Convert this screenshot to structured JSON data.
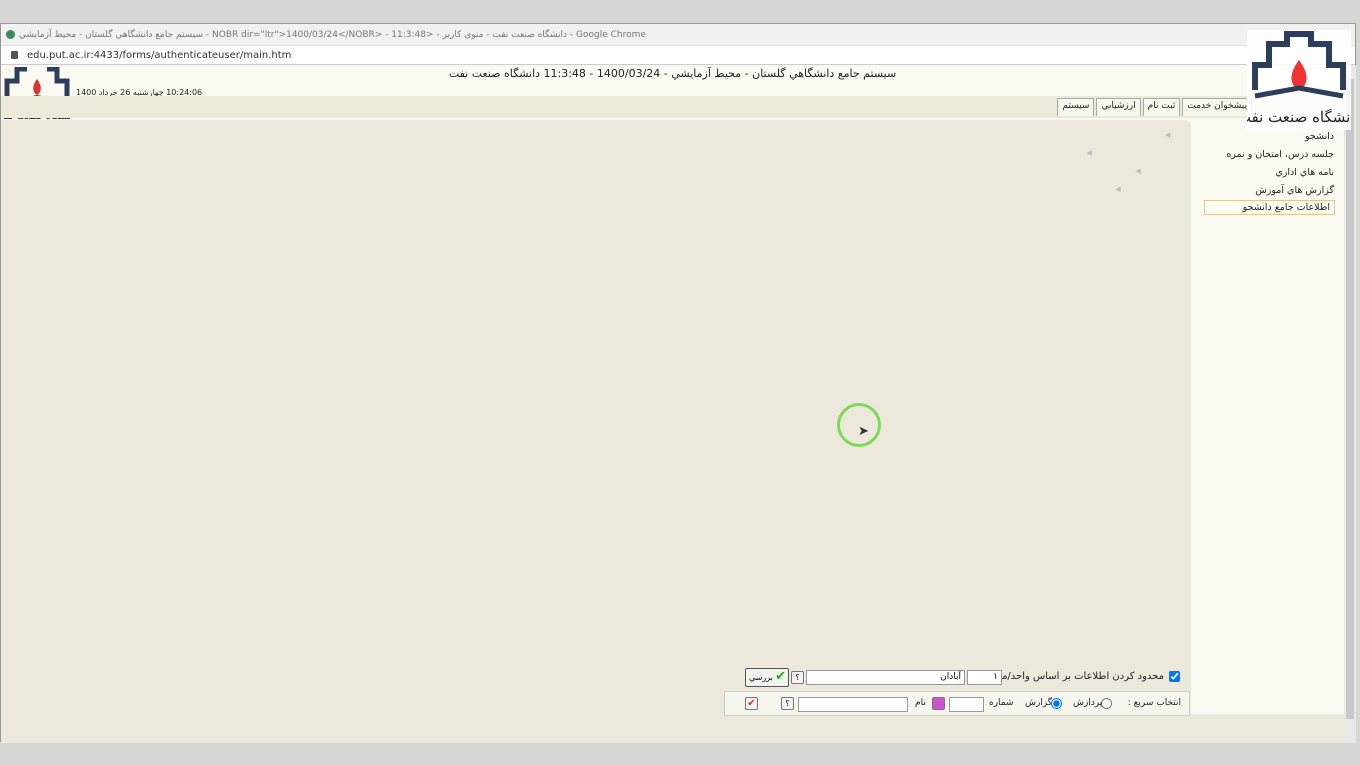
{
  "browser": {
    "title": "سيستم جامع دانشگاهي گلستان - محيط آزمايشي - NOBR dir=\"ltr\">1400/03/24</NOBR> - 11:3:48> - دانشگاه صنعت نفت - منوی کاربر - Google Chrome",
    "url": "edu.put.ac.ir:4433/forms/authenticateuser/main.htm"
  },
  "header": {
    "title": "سيستم جامع دانشگاهي گلستان - محيط آزمايشي - 1400/03/24 - 11:3:48   دانشگاه صنعت نفت",
    "datetime": "10:24:06 چهارشنبه 26 خرداد 1400",
    "logo_text": "دانشگاه صنعت نفت"
  },
  "tabs": [
    "پيشخوان خدمت",
    "ثبت نام",
    "ارزشيابي",
    "سيستم"
  ],
  "menu": [
    "دانشجو",
    "جلسه درس، امتحان و نمره",
    "نامه هاي اداري",
    "گزارش هاي آموزش",
    "اطلاعات جامع دانشجو"
  ],
  "filter": {
    "label": "محدود كردن اطلاعات بر اساس واحد/مركز",
    "unit_code": "۱",
    "unit_name": "آبادان",
    "check_button": "بررسي",
    "help": "؟"
  },
  "quick": {
    "label": "انتخاب سريع :",
    "opt_process": "پردازش",
    "opt_report": "گزارش",
    "number_label": "شماره",
    "name_label": "نام",
    "help": "؟"
  }
}
